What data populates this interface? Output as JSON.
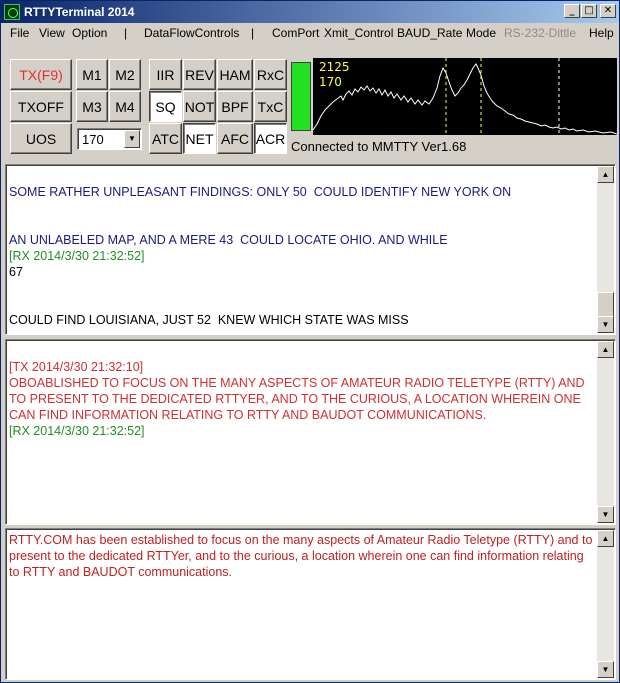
{
  "window": {
    "title": "RTTYTerminal 2014",
    "minimize_icon": "minimize-icon",
    "maximize_icon": "maximize-icon",
    "close_icon": "close-icon"
  },
  "menu": {
    "file": "File",
    "view": "View",
    "option": "Option",
    "sep1": "|",
    "dataflow": "DataFlowControls",
    "sep2": "|",
    "comport": "ComPort",
    "xmit": "Xmit_Control",
    "baud": "BAUD_Rate",
    "mode": "Mode",
    "rs232": "RS-232-Dittle",
    "help": "Help"
  },
  "toolbar": {
    "tx": "TX(F9)",
    "txoff": "TXOFF",
    "uos": "UOS",
    "m1": "M1",
    "m2": "M2",
    "m3": "M3",
    "m4": "M4",
    "iir": "IIR",
    "rev": "REV",
    "ham": "HAM",
    "rxc": "RxC",
    "sq": "SQ",
    "not": "NOT",
    "bpf": "BPF",
    "txc": "TxC",
    "atc": "ATC",
    "net": "NET",
    "afc": "AFC",
    "acr": "ACR",
    "shift_value": "170"
  },
  "spectrum": {
    "mark_freq": "2125",
    "shift": "170",
    "trace_color": "#ffffff",
    "marker_color": "#ffff40"
  },
  "status": "Connected to MMTTY Ver1.68",
  "rx_panel": {
    "lines": [
      "SOME RATHER UNPLEASANT FINDINGS: ONLY 50  COULD IDENTIFY NEW YORK ON",
      "AN UNLABELED MAP, AND A MERE 43  COULD LOCATE OHIO. AND WHILE",
      "[RX 2014/3/30 21:32:52]",
      "67",
      "COULD FIND LOUISIANA, JUST 52  KNEW WHICH STATE WAS MISS"
    ]
  },
  "tx_panel": {
    "lines": [
      "[TX 2014/3/30 21:32:10]",
      "OBOABLISHED TO FOCUS ON THE MANY ASPECTS OF AMATEUR RADIO TELETYPE (RTTY) AND TO PRESENT TO THE DEDICATED RTTYER, AND TO THE CURIOUS, A LOCATION WHEREIN ONE CAN FIND INFORMATION RELATING TO RTTY AND BAUDOT COMMUNICATIONS.",
      "[RX 2014/3/30 21:32:52]"
    ]
  },
  "type_panel": {
    "text": "RTTY.COM has been established to focus on the many aspects of Amateur Radio Teletype (RTTY) and to present to the dedicated RTTYer, and to the curious, a location wherein one can find information relating to RTTY and BAUDOT communications."
  },
  "colors": {
    "title_bar": "#0a246a",
    "rx_text": "#1a1a80",
    "timestamp": "#209020",
    "tx_text": "#d03030",
    "tx_button": "#e03030",
    "led": "#22e022"
  }
}
